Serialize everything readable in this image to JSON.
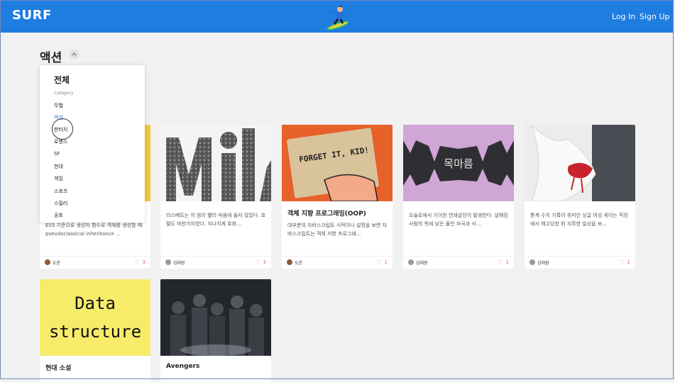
{
  "header": {
    "brand": "SURF",
    "login": "Log In",
    "signup": "Sign Up"
  },
  "page": {
    "title": "액션"
  },
  "dropdown": {
    "all": "전체",
    "category_label": "Category",
    "items": [
      "무협",
      "액션",
      "판타지",
      "로맨스",
      "SF",
      "현대",
      "게임",
      "스포츠",
      "스릴러",
      "공포"
    ],
    "selected": "액션"
  },
  "cards": [
    {
      "cover_text": "",
      "title": "",
      "excerpt": "ES5 기준으로 생성자 함수로 객체를 생성할 때 pseudoclassical inheritance ...",
      "author": "도윤",
      "likes": "3"
    },
    {
      "cover_text": "Mil",
      "title": "",
      "excerpt": "리스베트는 이 밤이 빨리 마음에 들지 않았다. 호텔도 마찬가지였다. 지나치게 호화...",
      "author": "김태원",
      "likes": "3"
    },
    {
      "cover_text": "FORGET IT, KID!",
      "title": "객체 지향 프로그래밍(OOP)",
      "excerpt": "대부분의 자바스크립트 서적이나 설명을 보면 자바스크립트는 객체 지향 프로그래...",
      "author": "도윤",
      "likes": "1"
    },
    {
      "cover_text": "목마름",
      "title": "",
      "excerpt": "오슬로에서 기이한 연쇄살인이 발생한다. 살해된 사람의 목에 남은 물린 자국과 사...",
      "author": "김태원",
      "likes": "1"
    },
    {
      "cover_text": "",
      "title": "",
      "excerpt": "통계 수치 기록이 취미인 싱글 여성 세이는 직장에서 해고당한 뒤 지루한 일상을 보...",
      "author": "김태원",
      "likes": "1"
    },
    {
      "cover_text": "Data structure",
      "title": "현대 소설",
      "excerpt": "",
      "author": "",
      "likes": ""
    },
    {
      "cover_text": "",
      "title": "Avengers",
      "excerpt": "",
      "author": "",
      "likes": ""
    }
  ],
  "colors": {
    "header": "#1f7de0",
    "accent": "#3d7de0",
    "heart": "#e06a6a"
  }
}
